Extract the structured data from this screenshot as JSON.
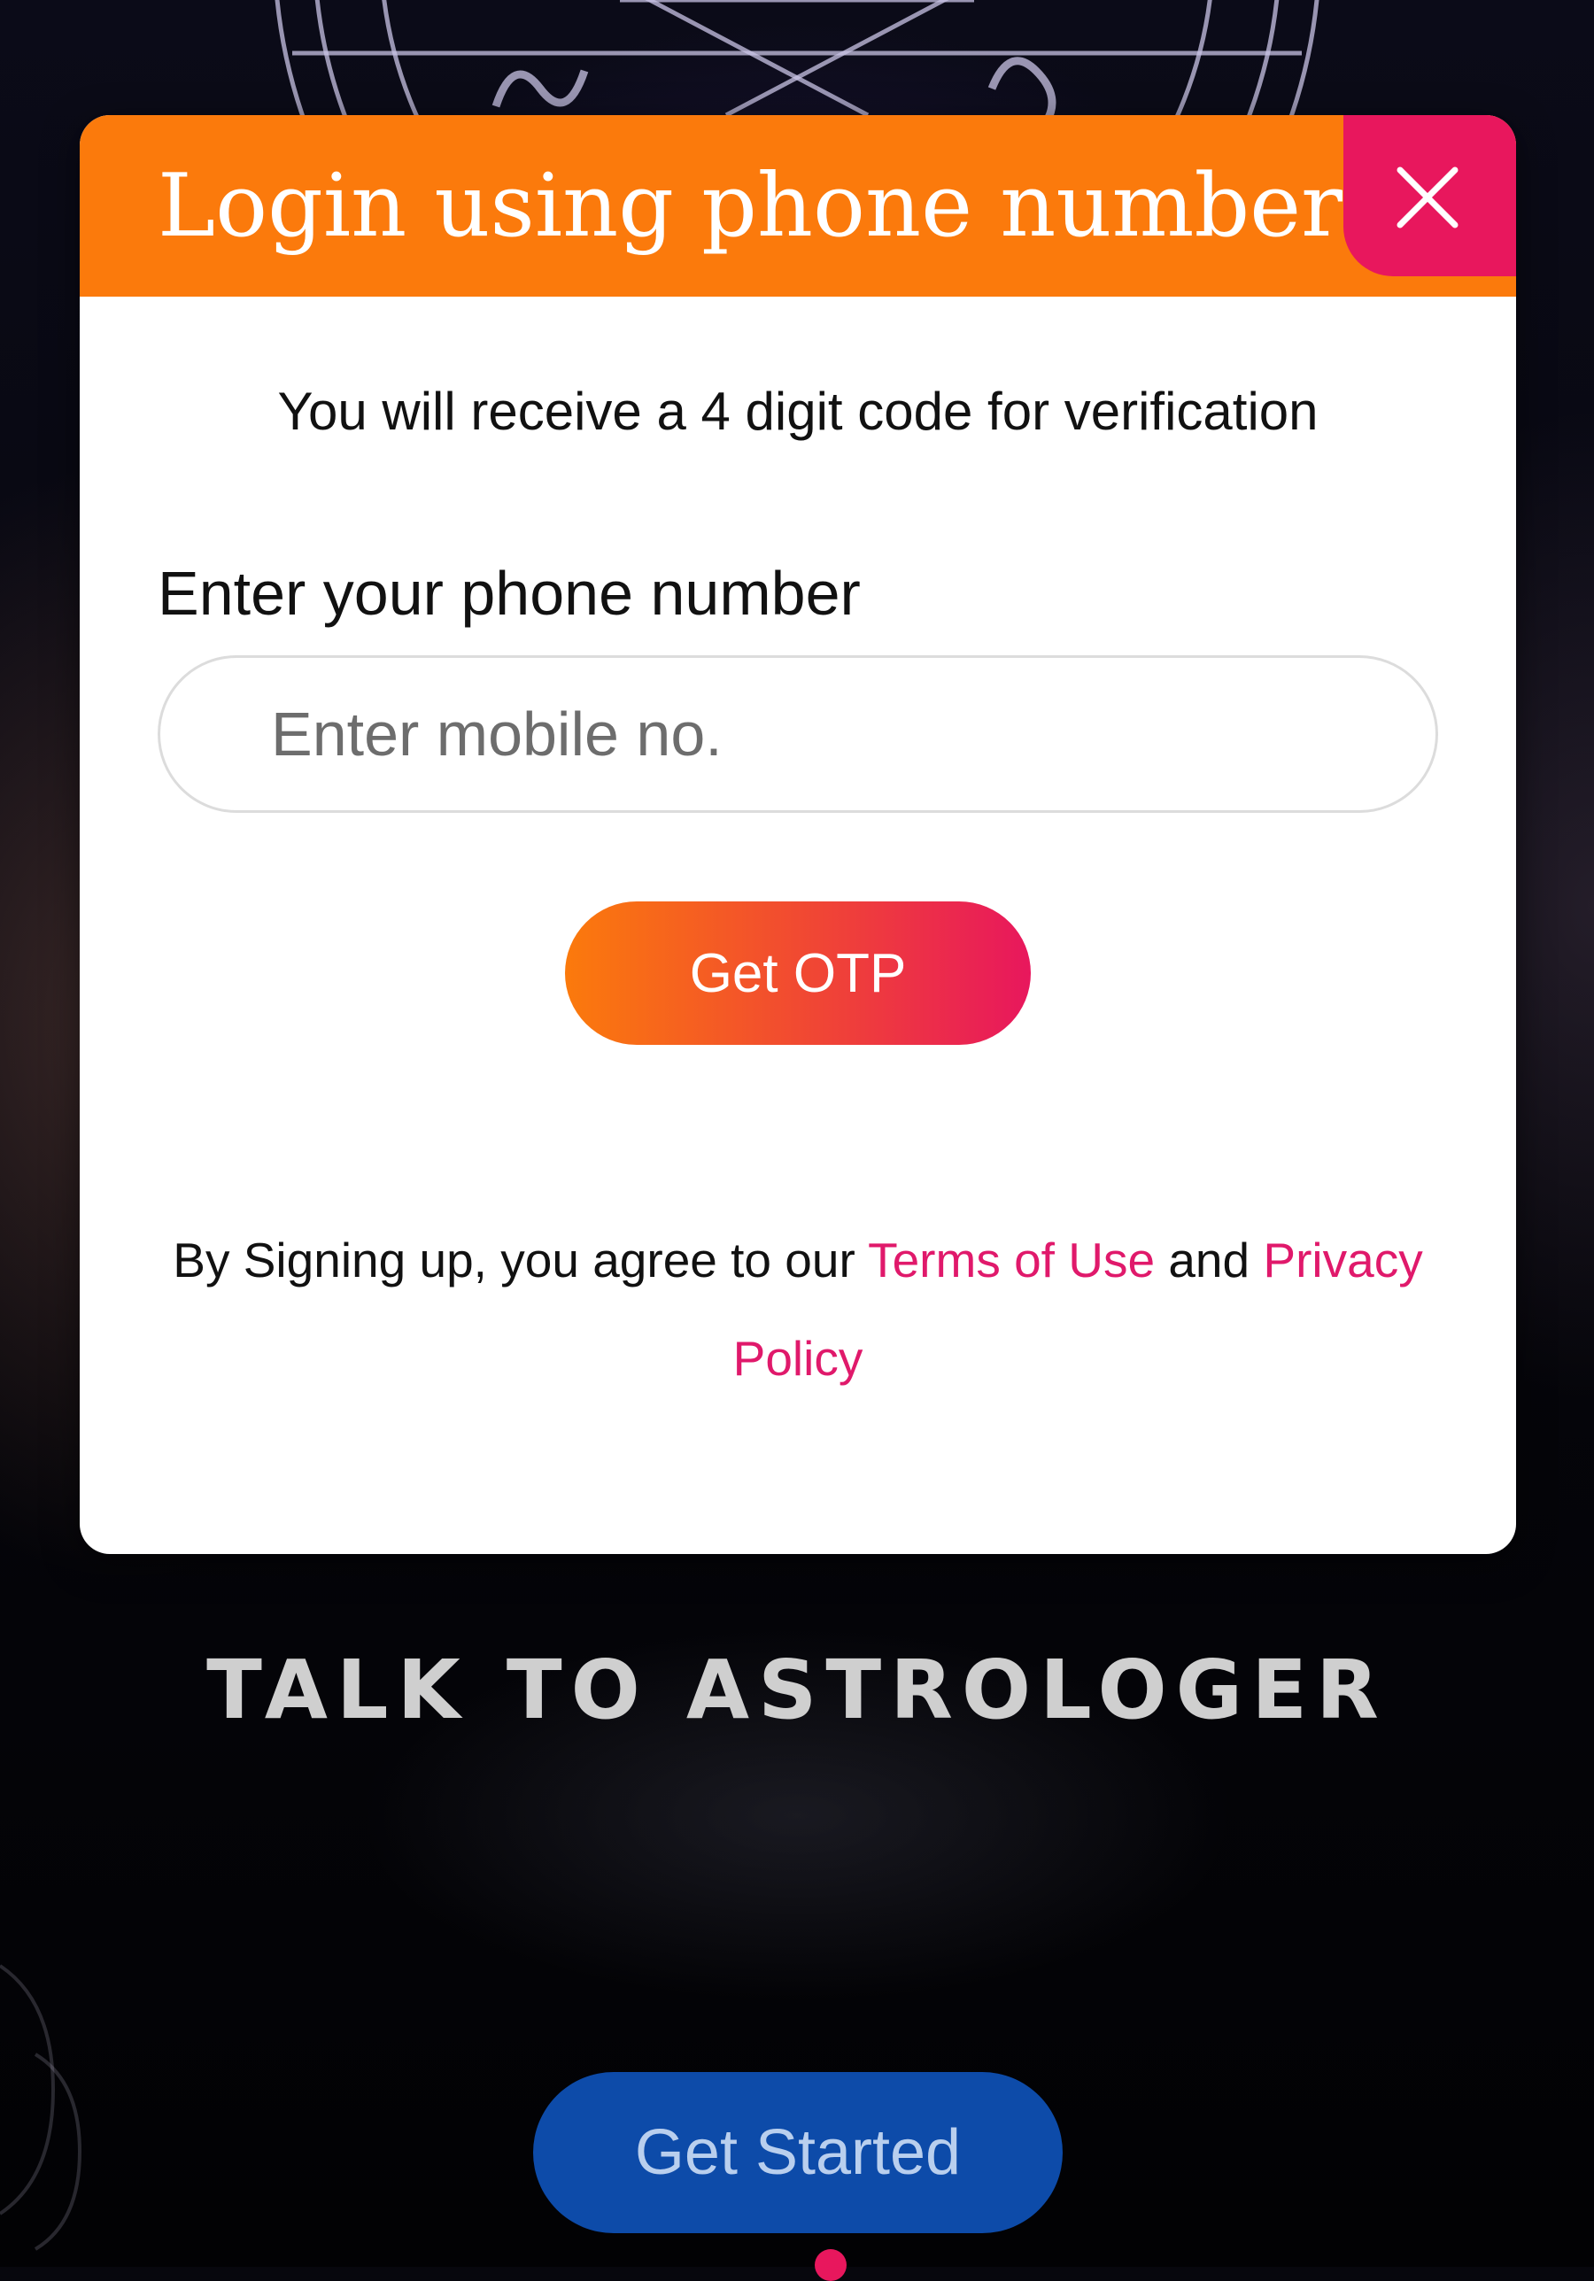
{
  "modal": {
    "title": "Login using phone number",
    "info_text": "You will receive a 4 digit code for verification",
    "phone_label": "Enter your phone number",
    "phone_placeholder": "Enter mobile no.",
    "phone_value": "",
    "otp_button_label": "Get OTP",
    "terms_prefix": "By Signing up, you agree to our ",
    "terms_link": "Terms of Use",
    "terms_and": " and ",
    "privacy_link": "Privacy Policy"
  },
  "background": {
    "tagline": "TALK TO ASTROLOGER",
    "get_started_label": "Get Started"
  },
  "icons": {
    "close": "close-icon"
  },
  "colors": {
    "header_orange": "#fb7a0c",
    "close_pink": "#e8175d",
    "link_pink": "#e0196b",
    "cta_blue": "#0d4ba9"
  }
}
